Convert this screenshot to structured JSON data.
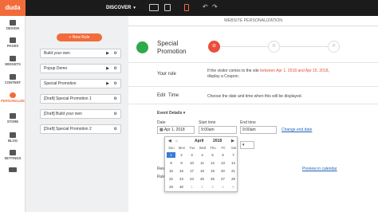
{
  "topbar": {
    "logo": "duda",
    "discover": "DISCOVER",
    "caret": "▾",
    "undo_icon": "↶",
    "redo_icon": "↷"
  },
  "sidebar": {
    "items": [
      {
        "label": "DESIGN",
        "icon": "brush-icon"
      },
      {
        "label": "PAGES",
        "icon": "pages-icon"
      },
      {
        "label": "WIDGETS",
        "icon": "plus-icon"
      },
      {
        "label": "CONTENT",
        "icon": "folder-icon"
      },
      {
        "label": "PERSONALIZE",
        "icon": "personalize-icon"
      },
      {
        "label": "STORE",
        "icon": "cart-icon"
      },
      {
        "label": "BLOG",
        "icon": "blog-icon"
      },
      {
        "label": "SETTINGS",
        "icon": "gear-icon"
      }
    ]
  },
  "rules_panel": {
    "new_rule": "+ New Rule",
    "items": [
      "Build your own",
      "Popup Demo",
      "Special Promotion",
      "[Draft] Special Promotion 1",
      "[Draft] Build your own",
      "[Draft] Special Promotion 2"
    ],
    "play_icon": "▶",
    "gear_icon": "⚙"
  },
  "main": {
    "title": "WEBSITE PERSONALIZATION",
    "campaign_title": "Special Promotion",
    "step_icons": [
      "⊘",
      "⚙",
      "⚙"
    ],
    "your_rule_label": "Your rule",
    "rule_text_1": "If the visitor comes to the site ",
    "rule_text_hl": "between Apr 1, 2018 and Apr 15, 2018",
    "rule_text_2": ",",
    "rule_text_line2": "display a Coupon.",
    "edit_label": "Edit",
    "time_label": "Time",
    "time_desc": "Choose the date and time when this will be displayed.",
    "event_details": "Event Details",
    "date_label": "Date",
    "start_time_label": "Start time",
    "end_time_label": "End time",
    "date_value": "Apr 1, 2018",
    "start_time_value": "9:00am",
    "end_time_value": "9:00am",
    "change_end_date": "Change end date",
    "recurrence_label": "Reo",
    "rule_label": "Rule",
    "preview_link": "Preview in calendar"
  },
  "calendar": {
    "month": "April",
    "year": "2018",
    "prev": "◀",
    "home": "⌂",
    "next": "▶",
    "weekdays": [
      "Sun",
      "Mon",
      "Tue",
      "Wed",
      "Thu",
      "Fri",
      "Sat"
    ],
    "rows": [
      [
        "1",
        "2",
        "3",
        "4",
        "5",
        "6",
        "7"
      ],
      [
        "8",
        "9",
        "10",
        "11",
        "12",
        "13",
        "14"
      ],
      [
        "15",
        "16",
        "17",
        "18",
        "19",
        "20",
        "21"
      ],
      [
        "22",
        "23",
        "24",
        "25",
        "26",
        "27",
        "28"
      ],
      [
        "29",
        "30",
        "1",
        "2",
        "3",
        "4",
        "5"
      ]
    ],
    "selected": "1"
  }
}
